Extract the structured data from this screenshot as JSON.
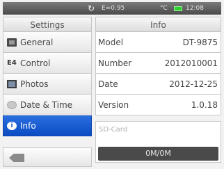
{
  "status_bar": {
    "refresh_icon": "refresh-icon",
    "emissivity": "E=0.95",
    "unit": "°C",
    "battery_icon": "battery-icon",
    "time": "12:08"
  },
  "settings": {
    "title": "Settings",
    "menu": [
      {
        "label": "General",
        "icon": "general-icon",
        "selected": false
      },
      {
        "label": "Control",
        "icon": "control-icon",
        "selected": false
      },
      {
        "label": "Photos",
        "icon": "photos-icon",
        "selected": false
      },
      {
        "label": "Date & Time",
        "icon": "clock-icon",
        "selected": false
      },
      {
        "label": "Info",
        "icon": "info-icon",
        "selected": true
      }
    ],
    "back_icon": "back-icon"
  },
  "info": {
    "title": "Info",
    "rows": [
      {
        "label": "Model",
        "value": "DT-9875"
      },
      {
        "label": "Number",
        "value": "2012010001"
      },
      {
        "label": "Date",
        "value": "2012-12-25"
      },
      {
        "label": "Version",
        "value": "1.0.18"
      }
    ],
    "sd_card": {
      "label": "SD-Card",
      "usage": "0M/0M"
    }
  },
  "colors": {
    "selected_accent": "#0b4cc4",
    "battery": "#2fcf2f"
  }
}
